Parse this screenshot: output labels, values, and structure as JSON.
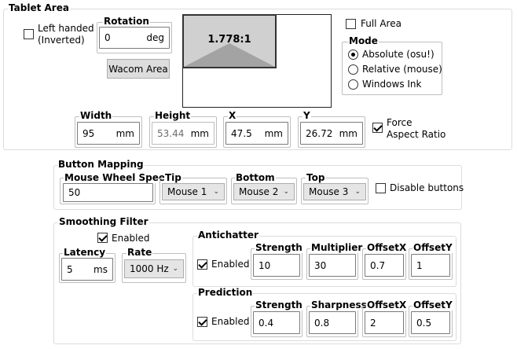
{
  "tablet_area": {
    "title": "Tablet Area",
    "left_handed": {
      "label_line1": "Left handed",
      "label_line2": "(Inverted)",
      "checked": false
    },
    "rotation": {
      "label": "Rotation",
      "value": "0",
      "unit": "deg"
    },
    "wacom_area_button": "Wacom Area",
    "preview": {
      "aspect_ratio": "1.778:1"
    },
    "full_area": {
      "label": "Full Area",
      "checked": false
    },
    "mode": {
      "title": "Mode",
      "options": [
        "Absolute (osu!)",
        "Relative (mouse)",
        "Windows Ink"
      ],
      "selected": "Absolute (osu!)"
    },
    "width": {
      "label": "Width",
      "value": "95",
      "unit": "mm"
    },
    "height": {
      "label": "Height",
      "value": "53.44",
      "unit": "mm"
    },
    "x": {
      "label": "X",
      "value": "47.5",
      "unit": "mm"
    },
    "y": {
      "label": "Y",
      "value": "26.72",
      "unit": "mm"
    },
    "force_aspect": {
      "label_line1": "Force",
      "label_line2": "Aspect Ratio",
      "checked": true
    }
  },
  "button_mapping": {
    "title": "Button Mapping",
    "wheel_speed": {
      "label": "Mouse Wheel Speed",
      "value": "50"
    },
    "tip": {
      "label": "Tip",
      "value": "Mouse 1"
    },
    "bottom": {
      "label": "Bottom",
      "value": "Mouse 2"
    },
    "top": {
      "label": "Top",
      "value": "Mouse 3"
    },
    "disable_buttons": {
      "label": "Disable buttons",
      "checked": false
    }
  },
  "smoothing": {
    "title": "Smoothing Filter",
    "enabled": {
      "label": "Enabled",
      "checked": true
    },
    "latency": {
      "label": "Latency",
      "value": "5",
      "unit": "ms"
    },
    "rate": {
      "label": "Rate",
      "value": "1000 Hz"
    },
    "antichatter": {
      "title": "Antichatter",
      "enabled": {
        "label": "Enabled",
        "checked": true
      },
      "strength": {
        "label": "Strength",
        "value": "10"
      },
      "multiplier": {
        "label": "Multiplier",
        "value": "30"
      },
      "offset_x": {
        "label": "OffsetX",
        "value": "0.7"
      },
      "offset_y": {
        "label": "OffsetY",
        "value": "1"
      }
    },
    "prediction": {
      "title": "Prediction",
      "enabled": {
        "label": "Enabled",
        "checked": true
      },
      "strength": {
        "label": "Strength",
        "value": "0.4"
      },
      "sharpness": {
        "label": "Sharpness",
        "value": "0.8"
      },
      "offset_x": {
        "label": "OffsetX",
        "value": "2"
      },
      "offset_y": {
        "label": "OffsetY",
        "value": "0.5"
      }
    }
  }
}
